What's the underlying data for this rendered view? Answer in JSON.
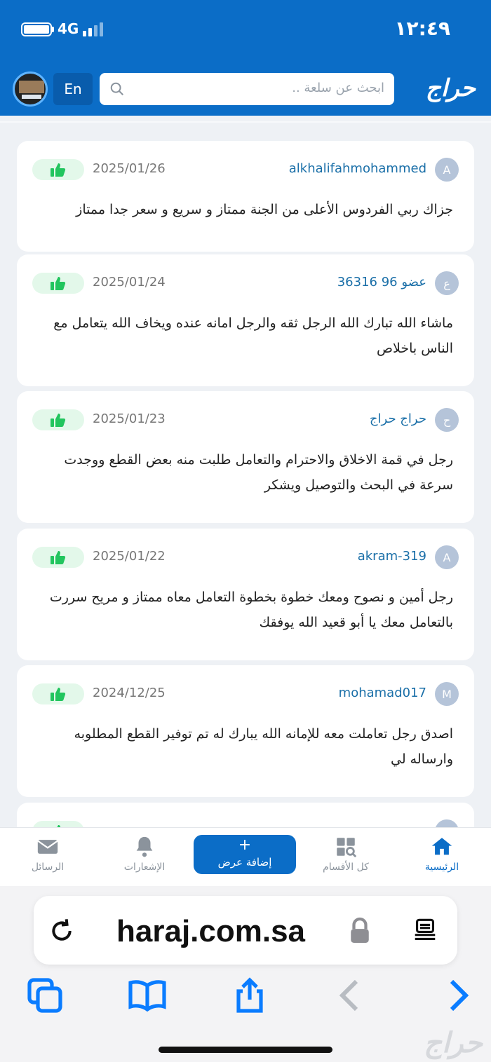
{
  "status_bar": {
    "time": "١٢:٤٩",
    "network": "4G"
  },
  "header": {
    "lang_button": "En",
    "search_placeholder": "ابحث عن سلعة ..",
    "logo_text": "حراج"
  },
  "reviews": [
    {
      "avatar_letter": "A",
      "user": "alkhalifahmohammed",
      "date": "2025/01/26",
      "text": "جزاك ربي الفردوس الأعلى من الجنة ممتاز و سريع و سعر جدا ممتاز"
    },
    {
      "avatar_letter": "ع",
      "user": "عضو 96 36316",
      "date": "2025/01/24",
      "text": "ماشاء الله تبارك الله الرجل ثقه والرجل امانه عنده ويخاف الله يتعامل مع الناس باخلاص"
    },
    {
      "avatar_letter": "ح",
      "user": "حراج حراج",
      "date": "2025/01/23",
      "text": "رجل في قمة الاخلاق والاحترام والتعامل طلبت منه بعض القطع ووجدت سرعة في البحث والتوصيل ويشكر"
    },
    {
      "avatar_letter": "A",
      "user": "akram-319",
      "date": "2025/01/22",
      "text": "رجل أمين و نصوح ومعك خطوة بخطوة التعامل معاه ممتاز و مريح سررت بالتعامل معك يا أبو قعيد الله يوفقك"
    },
    {
      "avatar_letter": "M",
      "user": "mohamad017",
      "date": "2024/12/25",
      "text": "اصدق رجل تعاملت معه للإمانه الله يبارك له تم توفير القطع المطلوبه وارساله لي"
    },
    {
      "avatar_letter": "",
      "user": "",
      "date": "",
      "text": ""
    }
  ],
  "bottom_nav": {
    "home": "الرئيسية",
    "categories": "كل الأقسام",
    "add_offer_plus": "+",
    "add_offer": "إضافة عرض",
    "notifications": "الإشعارات",
    "messages": "الرسائل"
  },
  "browser": {
    "url": "haraj.com.sa"
  },
  "watermark": "حراج",
  "colors": {
    "brand": "#0b6dc7",
    "like_green": "#22c55e",
    "username": "#1a6fa8"
  }
}
